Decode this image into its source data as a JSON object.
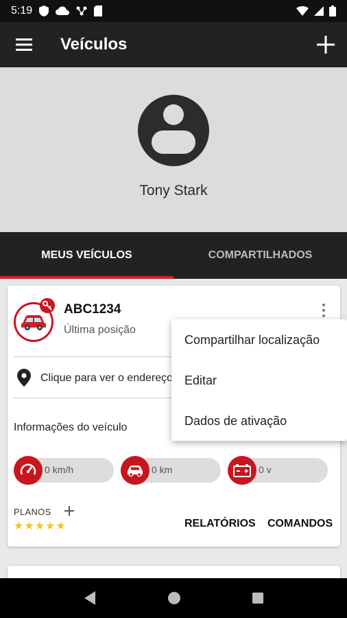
{
  "status_bar": {
    "time": "5:19"
  },
  "app_bar": {
    "title": "Veículos"
  },
  "profile": {
    "name": "Tony Stark"
  },
  "tabs": [
    {
      "label": "MEUS VEÍCULOS",
      "active": true
    },
    {
      "label": "COMPARTILHADOS",
      "active": false
    }
  ],
  "vehicle": {
    "plate": "ABC1234",
    "subtitle": "Última posição",
    "address": "Clique para ver o endereço",
    "info_title": "Informações do veículo",
    "metrics": [
      {
        "icon": "speedometer-icon",
        "value": "0 km/h"
      },
      {
        "icon": "car-icon",
        "value": "0 km"
      },
      {
        "icon": "battery-icon",
        "value": "0 v"
      }
    ],
    "plans_label": "PLANOS",
    "rating": 5,
    "stars": "★★★★★",
    "reports_label": "RELATÓRIOS",
    "commands_label": "COMANDOS"
  },
  "menu": {
    "items": [
      "Compartilhar localização",
      "Editar",
      "Dados de ativação"
    ]
  },
  "colors": {
    "accent": "#c8161e",
    "appbar": "#222222",
    "star": "#f5c518"
  }
}
